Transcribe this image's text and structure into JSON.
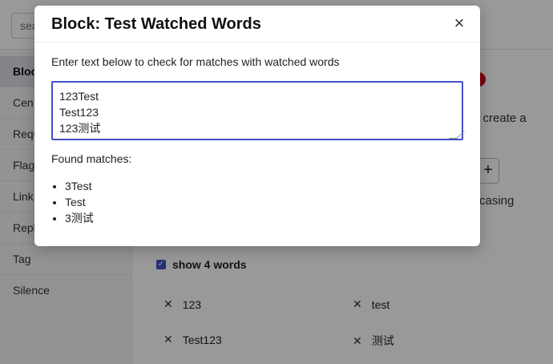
{
  "background": {
    "search": {
      "placeholder": "sea"
    },
    "sidebar": {
      "items": [
        {
          "label": "Block",
          "active": true
        },
        {
          "label": "Cen"
        },
        {
          "label": "Requ"
        },
        {
          "label": "Flag"
        },
        {
          "label": "Link"
        },
        {
          "label": "Repl"
        },
        {
          "label": "Tag"
        },
        {
          "label": "Silence"
        }
      ]
    },
    "main": {
      "create_text": "o create a",
      "casing_text": "casing",
      "add_label": "+",
      "show_words_label": "show 4 words",
      "words": [
        "123",
        "test",
        "Test123",
        "测试"
      ]
    }
  },
  "modal": {
    "title": "Block: Test Watched Words",
    "close_glyph": "×",
    "instructions": "Enter text below to check for matches with watched words",
    "textarea_value": "123Test\nTest123\n123测试",
    "found_label": "Found matches:",
    "matches": [
      "3Test",
      "Test",
      "3测试"
    ]
  },
  "colors": {
    "accent": "#4350c9",
    "danger": "#d0021b",
    "overlay": "rgba(0,0,0,0.4)"
  }
}
